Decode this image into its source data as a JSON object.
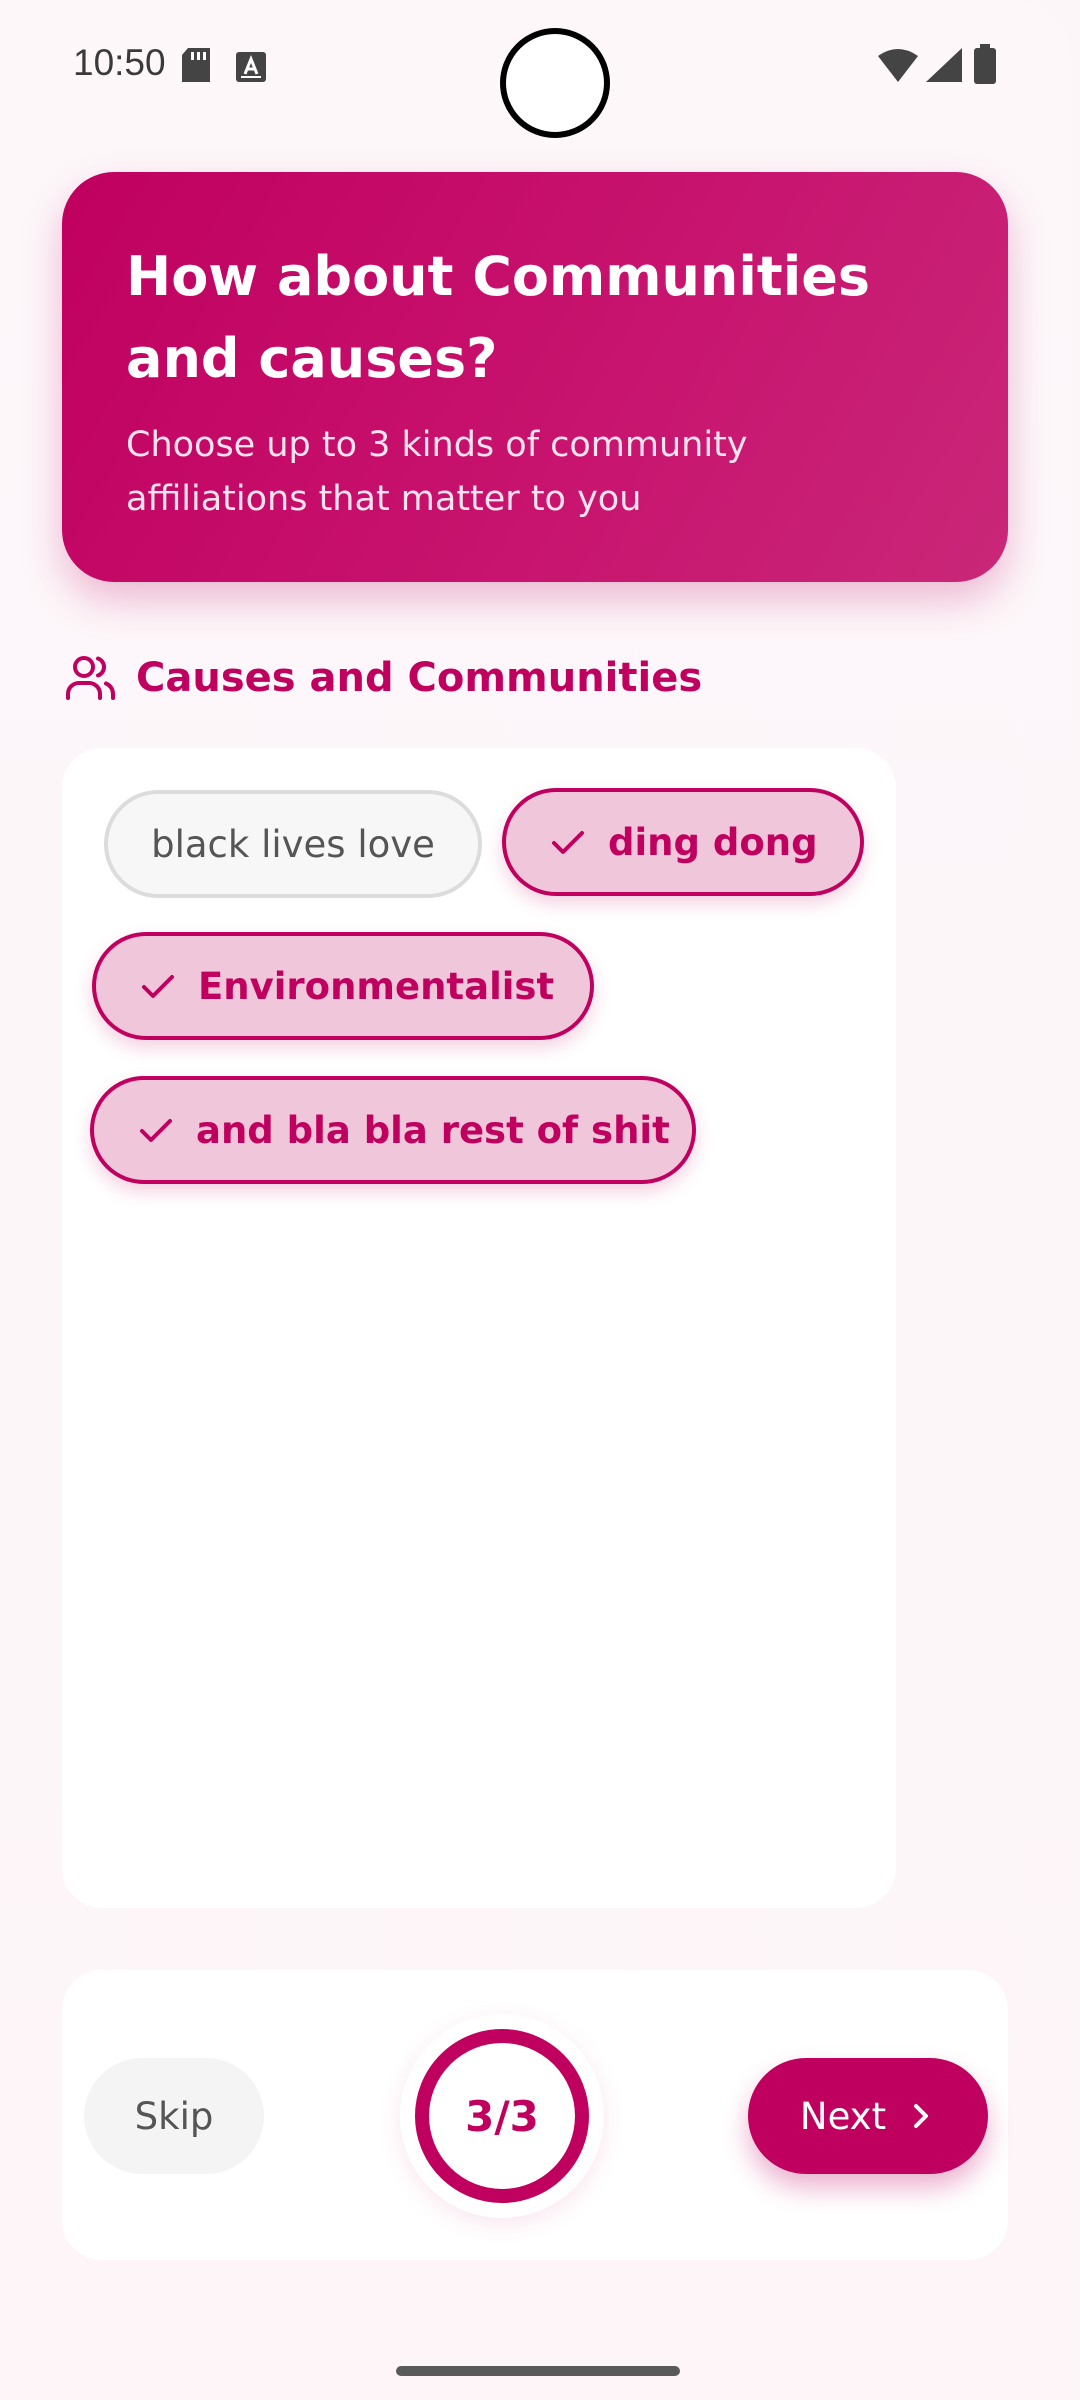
{
  "status_bar": {
    "time": "10:50",
    "left_icons": [
      "sd-card-icon",
      "keyboard-a-icon"
    ],
    "right_icons": [
      "wifi-icon",
      "signal-icon",
      "battery-icon"
    ]
  },
  "header": {
    "title": "How about Communities and causes?",
    "subtitle": "Choose up to 3 kinds of community affiliations that matter to you"
  },
  "section": {
    "icon": "users-icon",
    "title": "Causes and Communities"
  },
  "chips": [
    {
      "label": "black lives love",
      "selected": false
    },
    {
      "label": "ding dong",
      "selected": true
    },
    {
      "label": "Environmentalist",
      "selected": true
    },
    {
      "label": "and bla bla rest of shit",
      "selected": true
    }
  ],
  "footer": {
    "skip_label": "Skip",
    "progress_label": "3/3",
    "progress_fraction": 1.0,
    "next_label": "Next"
  },
  "colors": {
    "accent": "#c0005f",
    "chip_selected_bg": "#f0c7da",
    "chip_unselected_bg": "#f7f7f7",
    "page_bg": "#fdf7fa"
  }
}
